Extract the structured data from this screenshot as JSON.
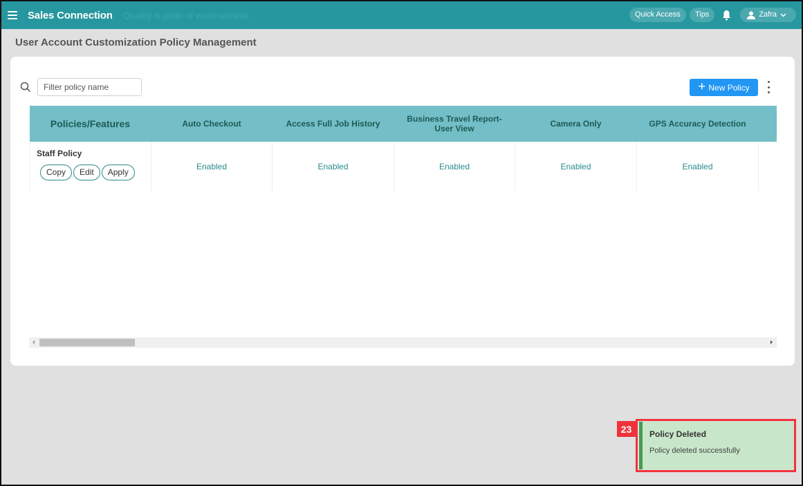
{
  "header": {
    "brand": "Sales Connection",
    "tagline": "Quality is pride of workmanship.",
    "quick_access_label": "Quick Access",
    "tips_label": "Tips",
    "user_name": "Zafra"
  },
  "page": {
    "title": "User Account Customization Policy Management"
  },
  "toolbar": {
    "filter_placeholder": "Filter policy name",
    "filter_value": "",
    "new_policy_label": "New Policy"
  },
  "table": {
    "columns": [
      "Policies/Features",
      "Auto Checkout",
      "Access Full Job History",
      "Business Travel Report-User View",
      "Camera Only",
      "GPS Accuracy Detection",
      ""
    ],
    "rows": [
      {
        "policy_name": "Staff Policy",
        "actions": [
          "Copy",
          "Edit",
          "Apply"
        ],
        "values": [
          "Enabled",
          "Enabled",
          "Enabled",
          "Enabled",
          "Enabled",
          ""
        ]
      }
    ]
  },
  "toast": {
    "badge": "23",
    "title": "Policy Deleted",
    "message": "Policy deleted successfully",
    "accent_color": "#4a9a55"
  },
  "colors": {
    "topbar": "#26979f",
    "table_header": "#73bec7",
    "primary_button": "#2196f3",
    "highlight": "#f0333a"
  }
}
